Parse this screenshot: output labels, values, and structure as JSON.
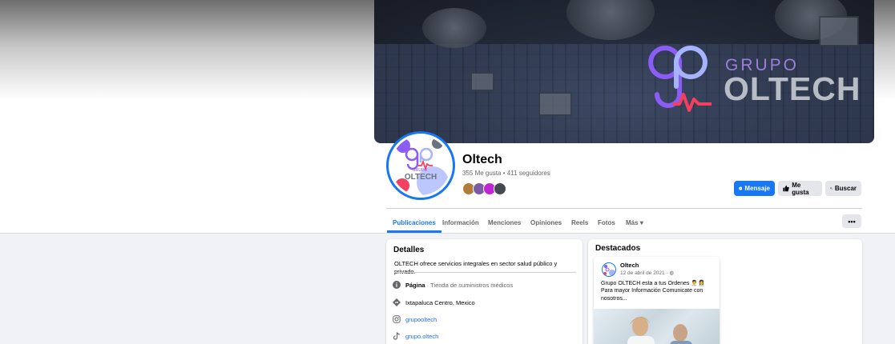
{
  "cover": {
    "brand_top": "GRUPO",
    "brand_main": "OLTECH",
    "colors": {
      "brand_purple": "#8b5cf6",
      "brand_pink": "#f43f5e",
      "brand_lavender": "#a5b4fc"
    }
  },
  "profile": {
    "name": "Oltech",
    "stats": "355 Me gusta • 411 seguidores",
    "avatar_text_small": "GRUPO",
    "avatar_text_main": "OLTECH"
  },
  "actions": {
    "message": "Mensaje",
    "like": "Me gusta",
    "search": "Buscar"
  },
  "tabs": [
    {
      "label": "Publicaciones",
      "active": true
    },
    {
      "label": "Información"
    },
    {
      "label": "Menciones"
    },
    {
      "label": "Opiniones"
    },
    {
      "label": "Reels"
    },
    {
      "label": "Fotos"
    },
    {
      "label": "Más ▾"
    }
  ],
  "more_button": "•••",
  "details": {
    "title": "Detalles",
    "description": "OLTECH ofrece servicios integrales en sector salud público y privado.",
    "page_label": "Página",
    "page_category": " · Tienda de suministros médicos",
    "location": "Ixtapaluca Centro, Mexico",
    "instagram": "grupooltech",
    "tiktok": "grupo.oltech"
  },
  "featured": {
    "title": "Destacados",
    "post": {
      "author": "Oltech",
      "date": "12 de abril de 2021 · ",
      "text": "Grupo OLTECH esta a tus Ordenes 👨‍⚕️👩‍⚕️ Para mayor Información Comunicate con nosotros..."
    }
  },
  "colors": {
    "accent": "#1877f2",
    "background": "#f0f2f5"
  }
}
